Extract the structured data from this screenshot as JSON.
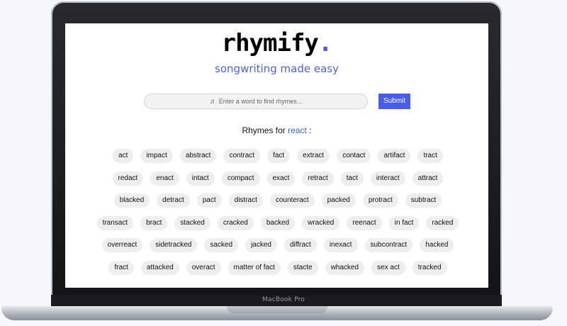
{
  "device": {
    "brand_label": "MacBook Pro"
  },
  "app": {
    "logo_text": "rhymify",
    "logo_dot": ".",
    "tagline": "songwriting made easy",
    "search": {
      "icon": "music-note-icon",
      "icon_glyph": "♬",
      "placeholder": "Enter a word to find rhymes..."
    },
    "submit_label": "Submit",
    "results": {
      "prefix": "Rhymes for",
      "query": "react",
      "suffix": ":",
      "rows": [
        [
          "act",
          "impact",
          "abstract",
          "contract",
          "fact",
          "extract",
          "contact",
          "artifact",
          "tract"
        ],
        [
          "redact",
          "enact",
          "intact",
          "compact",
          "exact",
          "retract",
          "tact",
          "interact",
          "attract"
        ],
        [
          "blacked",
          "detract",
          "pact",
          "distract",
          "counteract",
          "packed",
          "protract",
          "subtract"
        ],
        [
          "transact",
          "bract",
          "stacked",
          "cracked",
          "backed",
          "wracked",
          "reenact",
          "in fact",
          "racked"
        ],
        [
          "overreact",
          "sidetracked",
          "sacked",
          "jacked",
          "diffract",
          "inexact",
          "subcontract",
          "hacked"
        ],
        [
          "fract",
          "attacked",
          "overact",
          "matter of fact",
          "stacte",
          "whacked",
          "sex act",
          "tracked"
        ]
      ]
    },
    "colors": {
      "accent": "#4a5de8",
      "tagline": "#4a63d8"
    }
  }
}
